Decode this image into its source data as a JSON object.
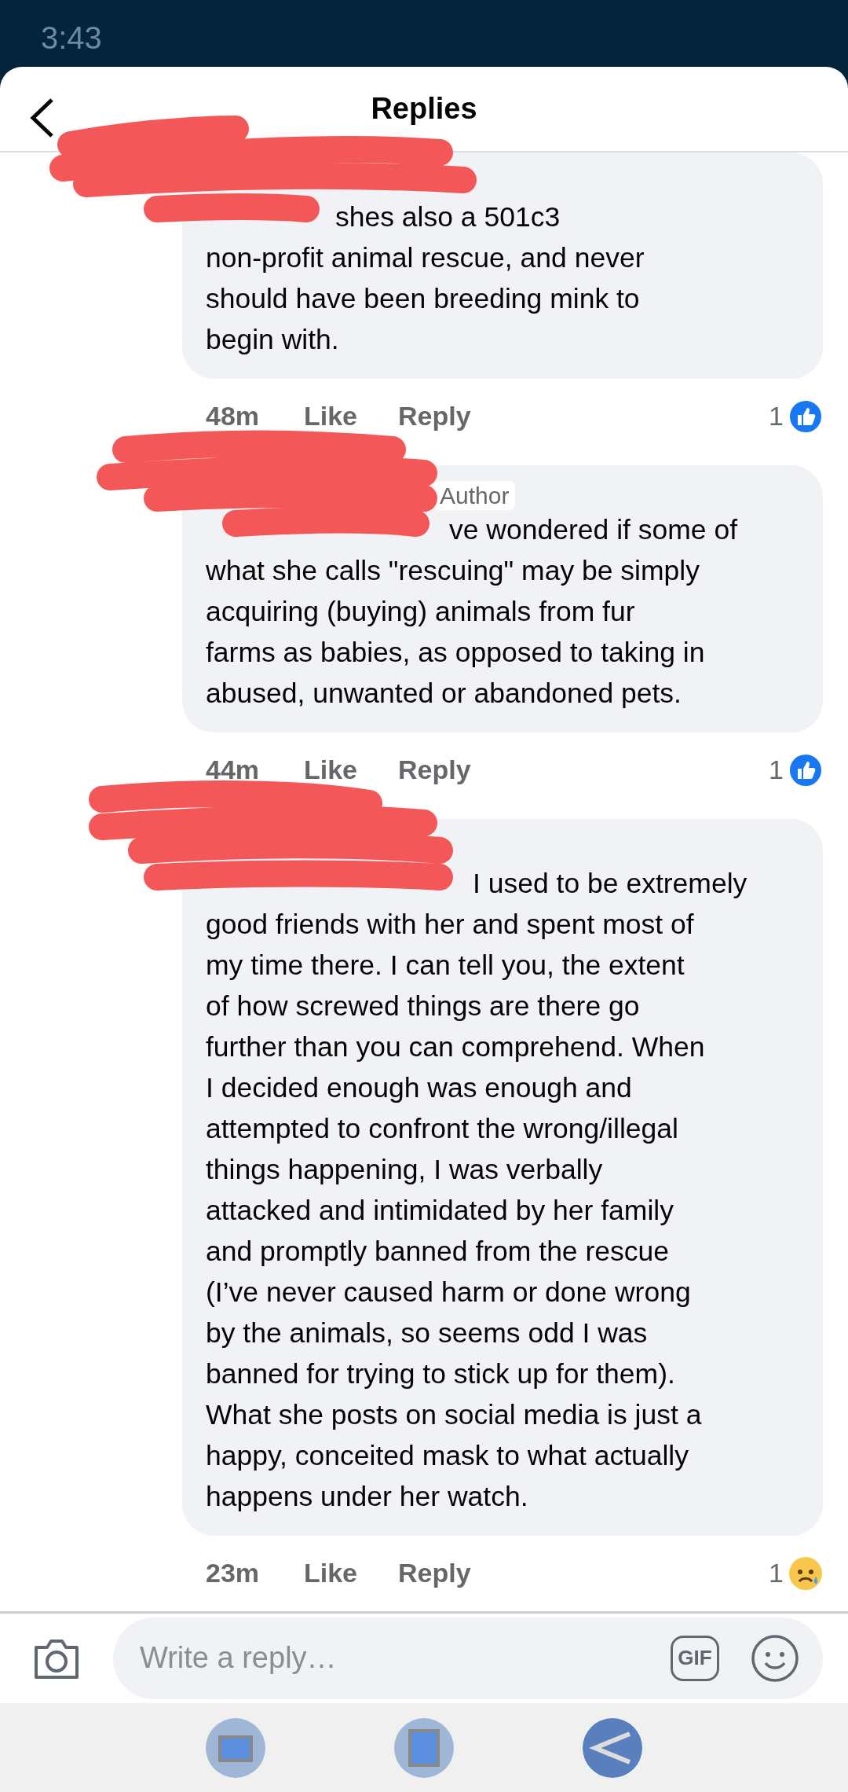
{
  "status_bar": {
    "time": "3:43"
  },
  "header": {
    "title": "Replies"
  },
  "comments": [
    {
      "redacted": true,
      "text": "shes also a 501c3\nnon-profit animal rescue, and never\nshould have been breeding mink to\nbegin with.",
      "time": "48m",
      "like": "Like",
      "reply": "Reply",
      "reaction": {
        "count": "1",
        "kind": "like"
      }
    },
    {
      "redacted": true,
      "author_badge": "Author",
      "text": "ve wondered if some of\nwhat she calls \"rescuing\" may be simply\nacquiring (buying) animals from fur\nfarms as babies, as opposed to taking in\nabused, unwanted or abandoned pets.",
      "time": "44m",
      "like": "Like",
      "reply": "Reply",
      "reaction": {
        "count": "1",
        "kind": "like"
      }
    },
    {
      "redacted": true,
      "text": "I used to be extremely\ngood friends with her and spent most of\nmy time there. I can tell you, the extent\nof how screwed things are there go\nfurther than you can comprehend. When\nI decided enough was enough and\nattempted to confront the wrong/illegal\nthings happening, I was verbally\nattacked and intimidated by her family\nand promptly banned from the rescue\n(I’ve never caused harm or done wrong\nby the animals, so seems odd I was\nbanned for trying to stick up for them).\nWhat she posts on social media is just a\nhappy, conceited mask to what actually\nhappens under her watch.",
      "time": "23m",
      "like": "Like",
      "reply": "Reply",
      "reaction": {
        "count": "1",
        "kind": "sad"
      }
    }
  ],
  "composer": {
    "placeholder": "Write a reply…",
    "gif": "GIF"
  }
}
